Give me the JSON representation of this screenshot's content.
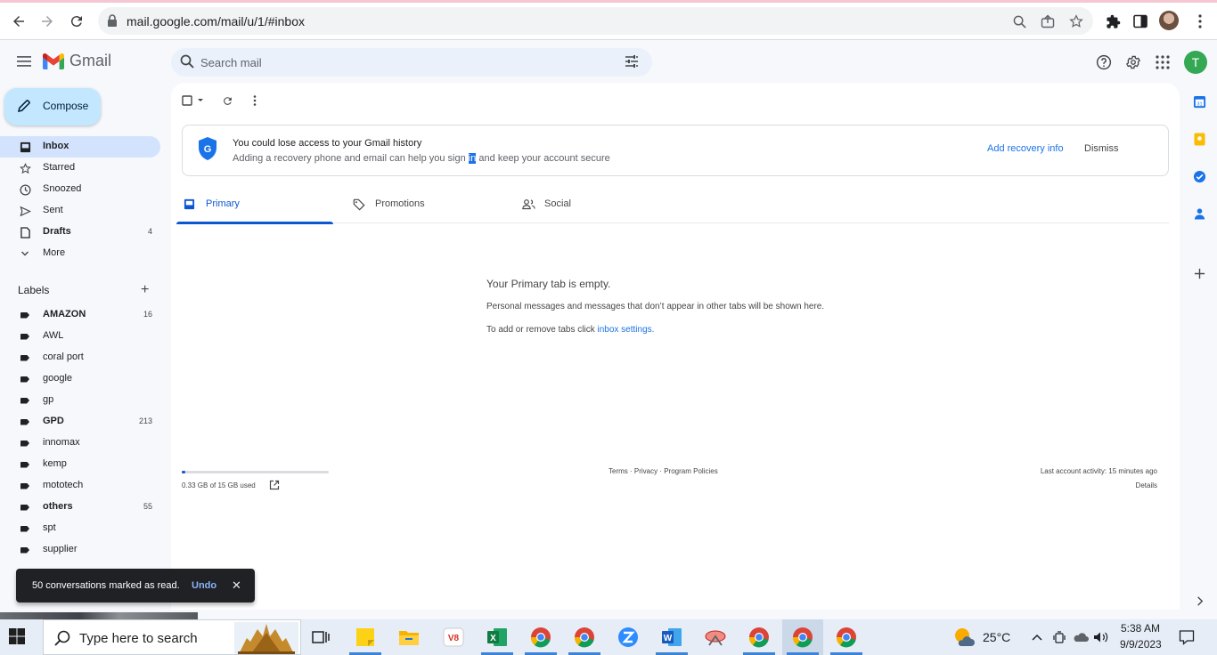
{
  "browser": {
    "url": "mail.google.com/mail/u/1/#inbox"
  },
  "header": {
    "app_name": "Gmail",
    "search_placeholder": "Search mail",
    "account_initial": "T"
  },
  "sidebar": {
    "compose_label": "Compose",
    "items": [
      {
        "label": "Inbox",
        "count": "",
        "icon": "inbox-icon"
      },
      {
        "label": "Starred",
        "count": "",
        "icon": "star-icon"
      },
      {
        "label": "Snoozed",
        "count": "",
        "icon": "clock-icon"
      },
      {
        "label": "Sent",
        "count": "",
        "icon": "send-icon"
      },
      {
        "label": "Drafts",
        "count": "4",
        "icon": "draft-icon"
      },
      {
        "label": "More",
        "count": "",
        "icon": "chevron-down-icon"
      }
    ],
    "labels_title": "Labels",
    "labels": [
      {
        "label": "AMAZON",
        "count": "16"
      },
      {
        "label": "AWL",
        "count": ""
      },
      {
        "label": "coral port",
        "count": ""
      },
      {
        "label": "google",
        "count": ""
      },
      {
        "label": "gp",
        "count": ""
      },
      {
        "label": "GPD",
        "count": "213"
      },
      {
        "label": "innomax",
        "count": ""
      },
      {
        "label": "kemp",
        "count": ""
      },
      {
        "label": "mototech",
        "count": ""
      },
      {
        "label": "others",
        "count": "55"
      },
      {
        "label": "spt",
        "count": ""
      },
      {
        "label": "supplier",
        "count": ""
      }
    ]
  },
  "banner": {
    "title": "You could lose access to your Gmail history",
    "subtitle_before": "Adding a recovery phone and email can help you sign ",
    "subtitle_highlight": "in",
    "subtitle_after": " and keep your account secure",
    "action": "Add recovery info",
    "dismiss": "Dismiss"
  },
  "tabs": [
    {
      "label": "Primary"
    },
    {
      "label": "Promotions"
    },
    {
      "label": "Social"
    }
  ],
  "empty": {
    "title": "Your Primary tab is empty.",
    "line1": "Personal messages and messages that don’t appear in other tabs will be shown here.",
    "line2_prefix": "To add or remove tabs click ",
    "line2_link": "inbox settings."
  },
  "footer": {
    "storage_text": "0.33 GB of 15 GB used",
    "storage_fraction": 0.022,
    "links": "Terms · Privacy · Program Policies",
    "activity": "Last account activity: 15 minutes ago",
    "details": "Details"
  },
  "snackbar": {
    "text": "50 conversations marked as read.",
    "undo": "Undo"
  },
  "taskbar": {
    "search_placeholder": "Type here to search",
    "temperature": "25°C",
    "time": "5:38 AM",
    "date": "9/9/2023"
  },
  "colors": {
    "accent": "#0b57d0",
    "active_nav": "#d3e3fd",
    "compose_bg": "#c2e7ff",
    "avatar": "#34a853"
  }
}
